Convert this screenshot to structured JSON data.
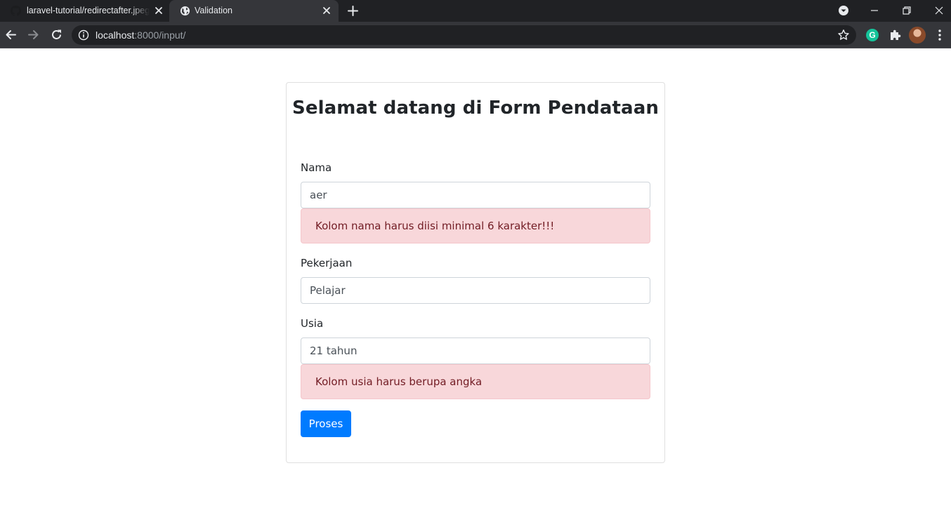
{
  "browser": {
    "tabs": [
      {
        "title": "laravel-tutorial/redirectafter.jpeg",
        "favicon": "github-icon",
        "active": false
      },
      {
        "title": "Validation",
        "favicon": "globe-icon",
        "active": true
      }
    ],
    "address_bar": {
      "host": "localhost",
      "rest": ":8000/input/"
    },
    "extensions": {
      "grammarly_letter": "G"
    },
    "colors": {
      "tabstrip": "#202124",
      "toolbar": "#35363a",
      "omnibox": "#202124",
      "grammarly": "#15c39a"
    }
  },
  "form": {
    "heading": "Selamat datang di Form Pendataan",
    "fields": {
      "nama": {
        "label": "Nama",
        "value": "aer",
        "error": "Kolom nama harus diisi minimal 6 karakter!!!"
      },
      "pekerjaan": {
        "label": "Pekerjaan",
        "value": "Pelajar"
      },
      "usia": {
        "label": "Usia",
        "value": "21 tahun",
        "error": "Kolom usia harus berupa angka"
      }
    },
    "submit_label": "Proses",
    "colors": {
      "primary": "#007bff",
      "alert_bg": "#f8d7da",
      "alert_text": "#721c24",
      "alert_border": "#f5c6cb"
    }
  }
}
